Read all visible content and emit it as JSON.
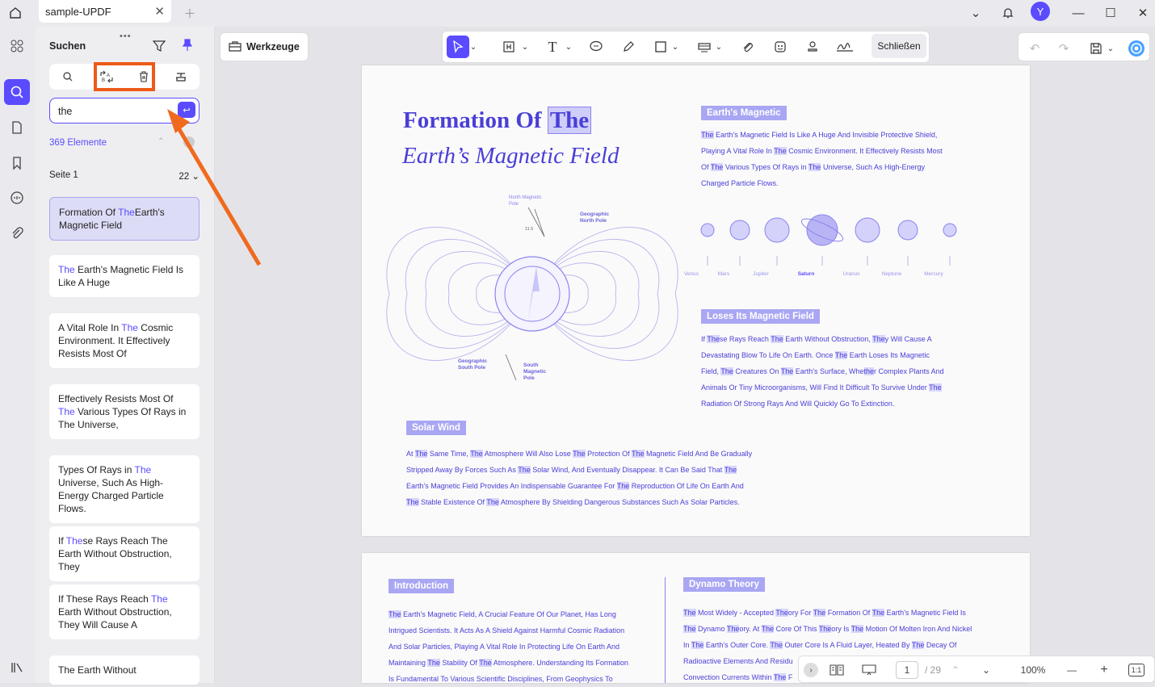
{
  "app": {
    "tab_title": "sample-UPDF",
    "avatar_letter": "Y"
  },
  "panel": {
    "title": "Suchen",
    "search_value": "the",
    "result_count": "369 Elemente",
    "page_label": "Seite 1",
    "page_count": "22",
    "results": [
      {
        "pre": "Formation Of ",
        "hl": "The",
        "post": "Earth's Magnetic Field"
      },
      {
        "pre": "",
        "hl": "The",
        "post": " Earth's Magnetic Field Is Like A Huge"
      },
      {
        "pre": "A Vital Role In ",
        "hl": "The",
        "post": " Cosmic Environment. It Effectively Resists Most Of"
      },
      {
        "pre": "Effectively Resists Most Of ",
        "hl": "The",
        "post": " Various Types Of Rays in The Universe,"
      },
      {
        "pre": "Types Of Rays in ",
        "hl": "The",
        "post": " Universe, Such As High-Energy Charged Particle Flows."
      },
      {
        "pre": "If ",
        "hl": "The",
        "post": "se Rays Reach The Earth Without Obstruction, They"
      },
      {
        "pre": "If These Rays Reach ",
        "hl": "The",
        "post": " Earth Without Obstruction, They Will Cause A"
      },
      {
        "pre": "The Earth Without",
        "hl": "",
        "post": ""
      }
    ]
  },
  "toolbar": {
    "tools_label": "Werkzeuge",
    "close_label": "Schließen"
  },
  "doc": {
    "title_pre": "Formation Of ",
    "title_hl": "The",
    "subtitle": "Earth’s Magnetic Field",
    "earth_badge": "Earth's Magnetic",
    "earth_lines": [
      "The Earth's Magnetic Field Is Like A Huge And Invisible Protective Shield,",
      "Playing A Vital Role In The Cosmic Environment. It Effectively Resists Most",
      "Of The Various Types Of Rays in The Universe, Such As High-Energy",
      "Charged Particle Flows."
    ],
    "planets": [
      "Venus",
      "Mars",
      "Jupiter",
      "Saturn",
      "Uranus",
      "Neptune",
      "Mercury"
    ],
    "loses_badge": "Loses Its Magnetic Field",
    "loses_lines": [
      "If These Rays Reach The Earth Without Obstruction, They Will Cause A",
      "Devastating Blow To Life On Earth. Once The Earth Loses Its Magnetic",
      "Field, The Creatures On The Earth's Surface, Whether Complex Plants And",
      "Animals Or Tiny Microorganisms, Will Find It Difficult To Survive Under The",
      "Radiation Of Strong Rays And Will Quickly Go To Extinction."
    ],
    "solar_badge": "Solar Wind",
    "solar_lines": [
      "At The Same Time, The Atmosphere Will Also Lose The Protection Of The Magnetic Field And Be Gradually",
      "Stripped Away By Forces Such As The Solar Wind, And Eventually Disappear. It Can Be Said That The",
      "Earth's Magnetic Field Provides An Indispensable Guarantee For The Reproduction Of Life On Earth And",
      "The Stable Existence Of The Atmosphere By Shielding Dangerous Substances Such As Solar Particles."
    ],
    "diagram": {
      "north_magnetic": "North Magnetic Pole",
      "geo_north": "Geographic North Pole",
      "geo_south": "Geographic South Pole",
      "south_magnetic": "South Magnetic Pole",
      "angle": "11.5"
    },
    "intro_badge": "Introduction",
    "intro_lines": [
      "The Earth's Magnetic Field, A Crucial Feature Of Our Planet, Has Long",
      "Intrigued Scientists. It Acts As A Shield Against Harmful Cosmic Radiation",
      "And Solar Particles, Playing A Vital Role In Protecting Life On Earth And",
      "Maintaining The Stability Of The Atmosphere. Understanding Its Formation",
      "Is Fundamental To Various Scientific Disciplines, From Geophysics To"
    ],
    "dynamo_badge": "Dynamo Theory",
    "dynamo_lines": [
      "The Most Widely - Accepted Theory For The Formation Of The Earth's Magnetic Field Is",
      "The Dynamo Theory. At The Core Of This Theory Is The Motion Of Molten Iron And Nickel",
      "In The Earth's Outer Core. The Outer Core Is A Fluid Layer, Heated By The Decay Of",
      "Radioactive Elements And Residu",
      "Convection Currents Within The F"
    ]
  },
  "bottom": {
    "page_current": "1",
    "page_total": "/ 29",
    "zoom": "100%",
    "fit": "1:1"
  }
}
